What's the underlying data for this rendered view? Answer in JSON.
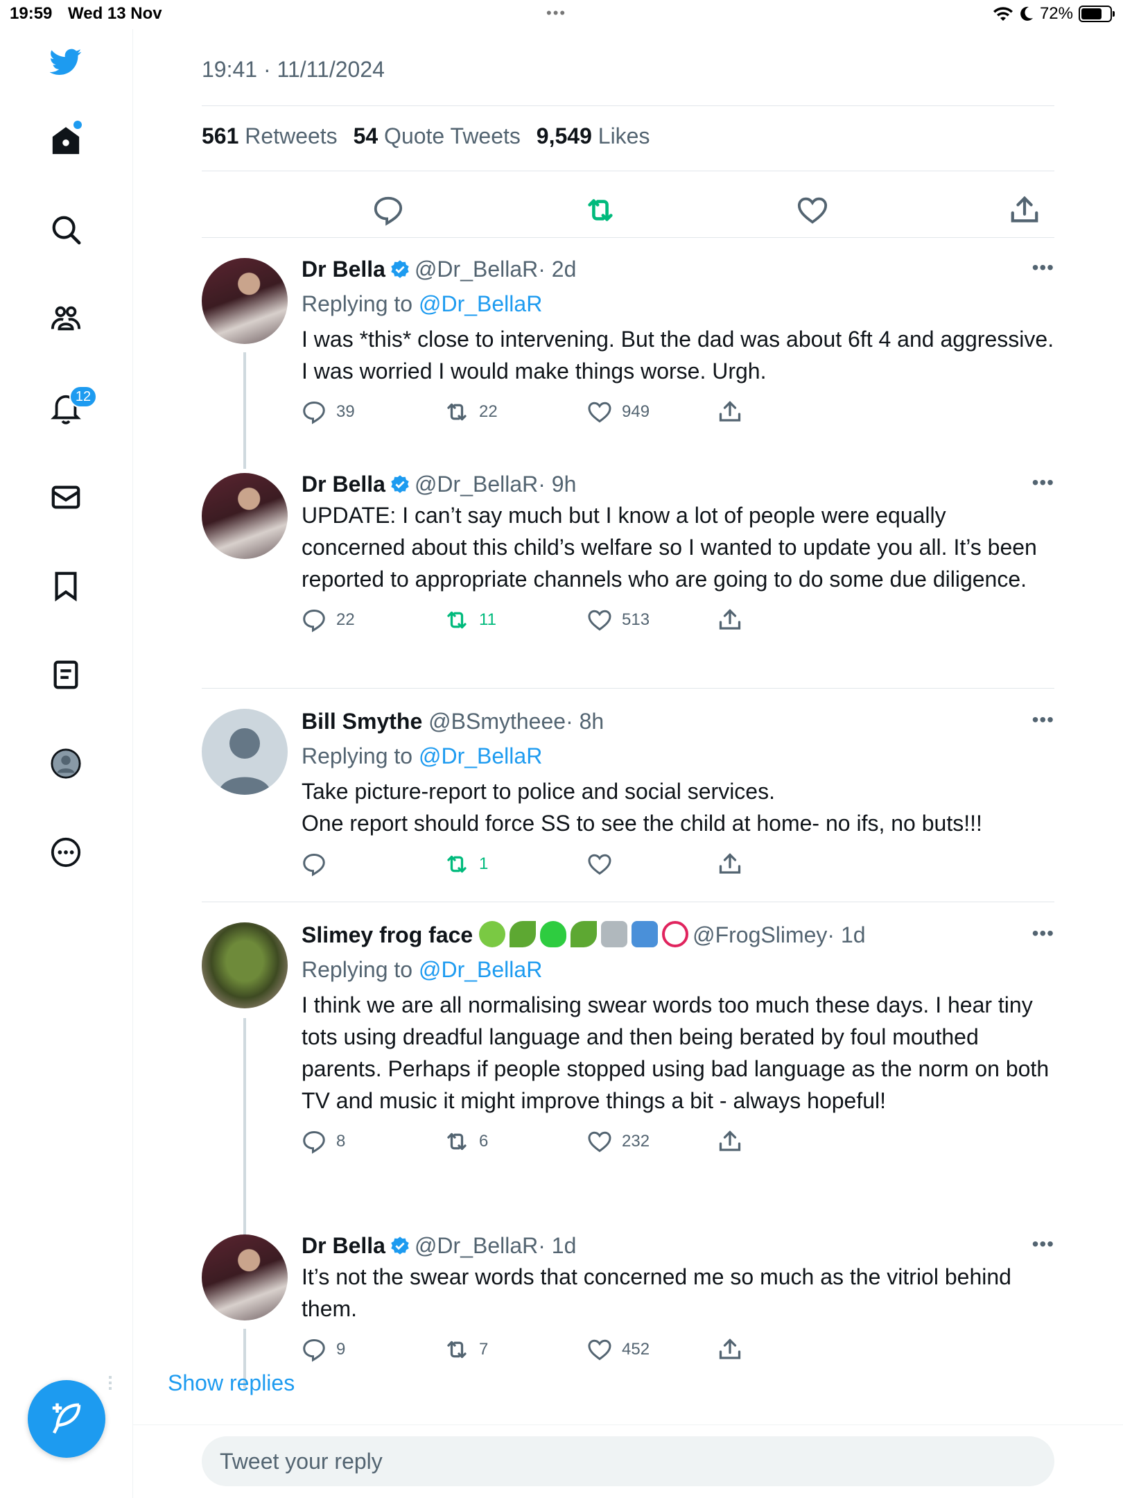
{
  "statusbar": {
    "time": "19:59",
    "date": "Wed 13 Nov",
    "dots": "•••",
    "battery": "72%"
  },
  "sidebar": {
    "items": [
      {
        "icon": "twitter-bird-icon"
      },
      {
        "icon": "home-icon"
      },
      {
        "icon": "search-icon"
      },
      {
        "icon": "communities-icon"
      },
      {
        "icon": "notifications-icon"
      },
      {
        "icon": "messages-icon"
      },
      {
        "icon": "bookmark-icon"
      },
      {
        "icon": "lists-icon"
      },
      {
        "icon": "profile-icon"
      },
      {
        "icon": "more-icon"
      }
    ],
    "notification_count": "12"
  },
  "tweet": {
    "timestamp": "19:41 · 11/11/2024",
    "retweets_count": "561",
    "retweets_label": "Retweets",
    "quotes_count": "54",
    "quotes_label": "Quote Tweets",
    "likes_count": "9,549",
    "likes_label": "Likes",
    "accent": "#1d9bf0",
    "retweet_green": "#00ba7c"
  },
  "replies": [
    {
      "name": "Dr Bella",
      "verified": true,
      "handle": "@Dr_BellaR",
      "meta": "· 2d",
      "replying_prefix": "Replying to",
      "replying_to": "@Dr_BellaR",
      "text": "I was *this* close to intervening. But the dad was about 6ft 4 and aggressive. I was worried I would make things worse. Urgh.",
      "reply_count": "39",
      "retweet_count": "22",
      "like_count": "949",
      "retweeted": false
    },
    {
      "name": "Dr Bella",
      "verified": true,
      "handle": "@Dr_BellaR",
      "meta": "· 9h",
      "text": "UPDATE: I can’t say much but I know a lot of people were equally concerned about this child’s welfare so I wanted to update you all. It’s been reported to appropriate channels who are going to do some due diligence.",
      "reply_count": "22",
      "retweet_count": "11",
      "like_count": "513",
      "retweeted": true
    },
    {
      "name": "Bill Smythe",
      "verified": false,
      "handle": "@BSmytheee",
      "meta": "· 8h",
      "replying_prefix": "Replying to",
      "replying_to": "@Dr_BellaR",
      "text": "Take picture-report to police and social services.\nOne report should force SS to see the child at home- no ifs, no buts!!!",
      "reply_count": "",
      "retweet_count": "1",
      "like_count": "",
      "retweeted": true
    },
    {
      "name": "Slimey frog face",
      "verified": false,
      "handle": "@FrogSlimey",
      "meta": "· 1d",
      "name_emojis": [
        "frog-emoji",
        "herb-emoji",
        "green-heart-emoji",
        "herb-emoji",
        "wastebasket-emoji",
        "put-litter-in-bin-emoji",
        "no-littering-emoji"
      ],
      "replying_prefix": "Replying to",
      "replying_to": "@Dr_BellaR",
      "text": "I think we are all normalising swear words too much these days.  I hear tiny tots using dreadful language and then being berated by foul mouthed parents. Perhaps if people stopped using bad language as the norm on both TV and music it might improve things a bit - always hopeful!",
      "reply_count": "8",
      "retweet_count": "6",
      "like_count": "232",
      "retweeted": false
    },
    {
      "name": "Dr Bella",
      "verified": true,
      "handle": "@Dr_BellaR",
      "meta": "· 1d",
      "text": "It’s not the swear words that concerned me so much as the vitriol behind them.",
      "reply_count": "9",
      "retweet_count": "7",
      "like_count": "452",
      "retweeted": false
    }
  ],
  "show_replies": "Show replies",
  "reply_box": {
    "placeholder": "Tweet your reply"
  }
}
